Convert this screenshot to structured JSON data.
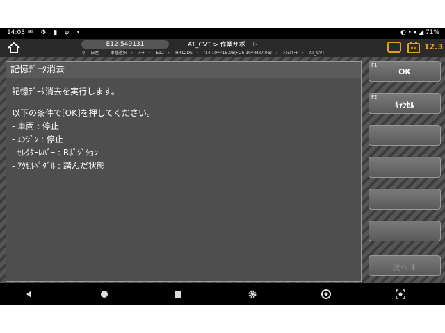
{
  "status": {
    "time": "14:03",
    "battery": "71%"
  },
  "header": {
    "vin": "E12-549131",
    "title": "AT_CVT > 作業サポート",
    "breadcrumb": [
      "日産",
      "車種選択",
      "ﾉｰﾄ",
      "E12",
      "HR12DE",
      "'14.10〜'15.06(H26.10〜H27.06)",
      "ｼｽﾃﾑｻｰﾁ",
      "AT_CVT"
    ],
    "voltage": "12.3"
  },
  "panel": {
    "title": "記憶ﾃﾞｰﾀ消去",
    "lines": [
      "記憶ﾃﾞｰﾀ消去を実行します。",
      "以下の条件で[OK]を押してください。",
      "- 車両 : 停止",
      "- ｴﾝｼﾞﾝ : 停止",
      "- ｾﾚｸﾀｰﾚﾊﾞｰ : Rﾎﾟｼﾞｼｮﾝ",
      "- ｱｸｾﾙﾍﾟﾀﾞﾙ : 踏んだ状態"
    ]
  },
  "fkeys": [
    {
      "tag": "F1",
      "label": "OK"
    },
    {
      "tag": "F2",
      "label": "ｷｬﾝｾﾙ"
    },
    {
      "tag": "",
      "label": ""
    },
    {
      "tag": "",
      "label": ""
    },
    {
      "tag": "",
      "label": ""
    },
    {
      "tag": "",
      "label": ""
    },
    {
      "tag": "",
      "label": "次へ ⬇"
    }
  ],
  "colors": {
    "accent": "#e6a020",
    "panel": "#4e4e4e",
    "bar": "#000000"
  },
  "icons": [
    "home-icon",
    "record-icon",
    "battery-icon",
    "back-icon",
    "home-circle-icon",
    "recents-icon",
    "settings-icon",
    "chrome-icon",
    "screenshot-icon"
  ]
}
